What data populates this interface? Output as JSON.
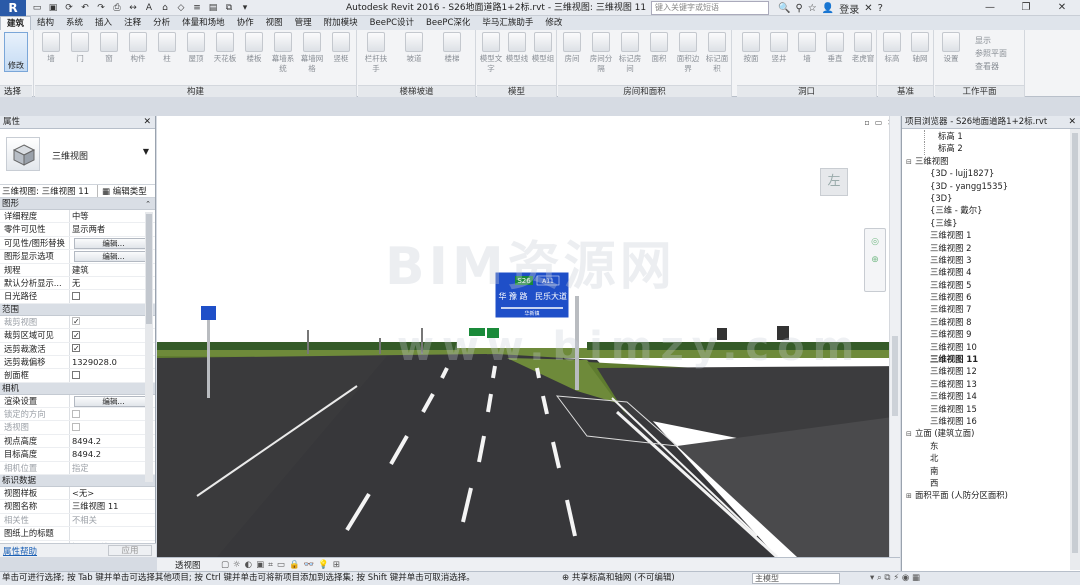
{
  "titlebar": {
    "logo": "R",
    "title": "Autodesk Revit 2016 -    S26地面道路1+2标.rvt - 三维视图: 三维视图 11",
    "search_placeholder": "键入关键字或短语",
    "user": "登录"
  },
  "menu": {
    "tabs": [
      "建筑",
      "结构",
      "系统",
      "插入",
      "注释",
      "分析",
      "体量和场地",
      "协作",
      "视图",
      "管理",
      "附加模块",
      "BeePC设计",
      "BeePC深化",
      "毕马汇族助手",
      "修改"
    ],
    "active_index": 0
  },
  "ribbon": {
    "modify": "修改",
    "select": "选择",
    "groups": {
      "build": "构建",
      "stairs": "楼梯坡道",
      "model": "模型",
      "room": "房间和面积",
      "opening": "洞口",
      "datum": "基准",
      "workplane": "工作平面"
    },
    "build_buttons": [
      "墙",
      "门",
      "窗",
      "构件",
      "柱",
      "屋顶",
      "天花板",
      "楼板",
      "幕墙系统",
      "幕墙网格",
      "竖梃"
    ],
    "stair_buttons": [
      "栏杆扶手",
      "坡道",
      "楼梯"
    ],
    "model_buttons": [
      "模型文字",
      "模型线",
      "模型组"
    ],
    "room_buttons": [
      "房间",
      "房间分隔",
      "标记房间",
      "面积",
      "面积边界",
      "标记面积"
    ],
    "opening_buttons": [
      "按面",
      "竖井",
      "墙",
      "垂直",
      "老虎窗"
    ],
    "datum_buttons": [
      "标高",
      "轴网"
    ],
    "workplane_buttons": [
      "设置"
    ],
    "workplane_small": [
      "显示",
      "参照平面",
      "查看器"
    ]
  },
  "properties": {
    "header": "属性",
    "type_name": "三维视图",
    "view_selector": "三维视图: 三维视图 11",
    "edit_type": "编辑类型",
    "sections": {
      "graphics": "图形",
      "extents": "范围",
      "camera": "相机",
      "identity": "标识数据"
    },
    "graphics_rows": [
      {
        "k": "详细程度",
        "v": "中等"
      },
      {
        "k": "零件可见性",
        "v": "显示两者"
      },
      {
        "k": "可见性/图形替换",
        "v": "编辑..."
      },
      {
        "k": "图形显示选项",
        "v": "编辑..."
      },
      {
        "k": "规程",
        "v": "建筑"
      },
      {
        "k": "默认分析显示...",
        "v": "无"
      },
      {
        "k": "日光路径",
        "v": ""
      }
    ],
    "extents_rows": [
      {
        "k": "裁剪视图",
        "v": ""
      },
      {
        "k": "裁剪区域可见",
        "v": ""
      },
      {
        "k": "远剪裁激活",
        "v": ""
      },
      {
        "k": "远剪裁偏移",
        "v": "1329028.0"
      },
      {
        "k": "剖面框",
        "v": ""
      }
    ],
    "camera_rows": [
      {
        "k": "渲染设置",
        "v": "编辑..."
      },
      {
        "k": "锁定的方向",
        "v": ""
      },
      {
        "k": "透视图",
        "v": ""
      },
      {
        "k": "视点高度",
        "v": "8494.2"
      },
      {
        "k": "目标高度",
        "v": "8494.2"
      },
      {
        "k": "相机位置",
        "v": "指定"
      }
    ],
    "identity_rows": [
      {
        "k": "视图样板",
        "v": "<无>"
      },
      {
        "k": "视图名称",
        "v": "三维视图 11"
      },
      {
        "k": "相关性",
        "v": "不相关"
      },
      {
        "k": "图纸上的标题",
        "v": ""
      },
      {
        "k": "工作集",
        "v": "视图\"三维"
      }
    ],
    "help": "属性帮助",
    "apply": "应用"
  },
  "viewport": {
    "viewcube_label": "左",
    "watermark": "BIM资源网",
    "watermark2": "www.bimzy.com",
    "sign": {
      "route": "S26",
      "route2": "A11",
      "line1": "华 豫 路",
      "line2": "民乐大道",
      "line3": "华新镇"
    }
  },
  "viewbar": {
    "label": "透视图"
  },
  "browser": {
    "header": "项目浏览器 - S26地面道路1+2标.rvt",
    "items": [
      {
        "level": 2,
        "text": "标高 1"
      },
      {
        "level": 2,
        "text": "标高 2"
      },
      {
        "level": 0,
        "text": "三维视图",
        "toggle": "⊟"
      },
      {
        "level": 1,
        "text": "{3D - lujj1827}"
      },
      {
        "level": 1,
        "text": "{3D - yangg1535}"
      },
      {
        "level": 1,
        "text": "{3D}"
      },
      {
        "level": 1,
        "text": "{三维 - 戴尔}"
      },
      {
        "level": 1,
        "text": "{三维}"
      },
      {
        "level": 1,
        "text": "三维视图 1"
      },
      {
        "level": 1,
        "text": "三维视图 2"
      },
      {
        "level": 1,
        "text": "三维视图 3"
      },
      {
        "level": 1,
        "text": "三维视图 4"
      },
      {
        "level": 1,
        "text": "三维视图 5"
      },
      {
        "level": 1,
        "text": "三维视图 6"
      },
      {
        "level": 1,
        "text": "三维视图 7"
      },
      {
        "level": 1,
        "text": "三维视图 8"
      },
      {
        "level": 1,
        "text": "三维视图 9"
      },
      {
        "level": 1,
        "text": "三维视图 10"
      },
      {
        "level": 1,
        "text": "三维视图 11",
        "selected": true
      },
      {
        "level": 1,
        "text": "三维视图 12"
      },
      {
        "level": 1,
        "text": "三维视图 13"
      },
      {
        "level": 1,
        "text": "三维视图 14"
      },
      {
        "level": 1,
        "text": "三维视图 15"
      },
      {
        "level": 1,
        "text": "三维视图 16"
      },
      {
        "level": 0,
        "text": "立面 (建筑立面)",
        "toggle": "⊟"
      },
      {
        "level": 1,
        "text": "东"
      },
      {
        "level": 1,
        "text": "北"
      },
      {
        "level": 1,
        "text": "南"
      },
      {
        "level": 1,
        "text": "西"
      },
      {
        "level": 0,
        "text": "面积平面 (人防分区面积)",
        "toggle": "⊞"
      }
    ]
  },
  "status": {
    "message": "单击可进行选择; 按 Tab 键并单击可选择其他项目; 按 Ctrl 键并单击可将新项目添加到选择集; 按 Shift 键并单击可取消选择。",
    "workset": "共享标高和轴网 (不可编辑)",
    "model": "主模型"
  },
  "colors": {
    "sign_blue": "#1f4fc8",
    "grass": "#6e8a3a",
    "asphalt": "#3a3a3c"
  }
}
